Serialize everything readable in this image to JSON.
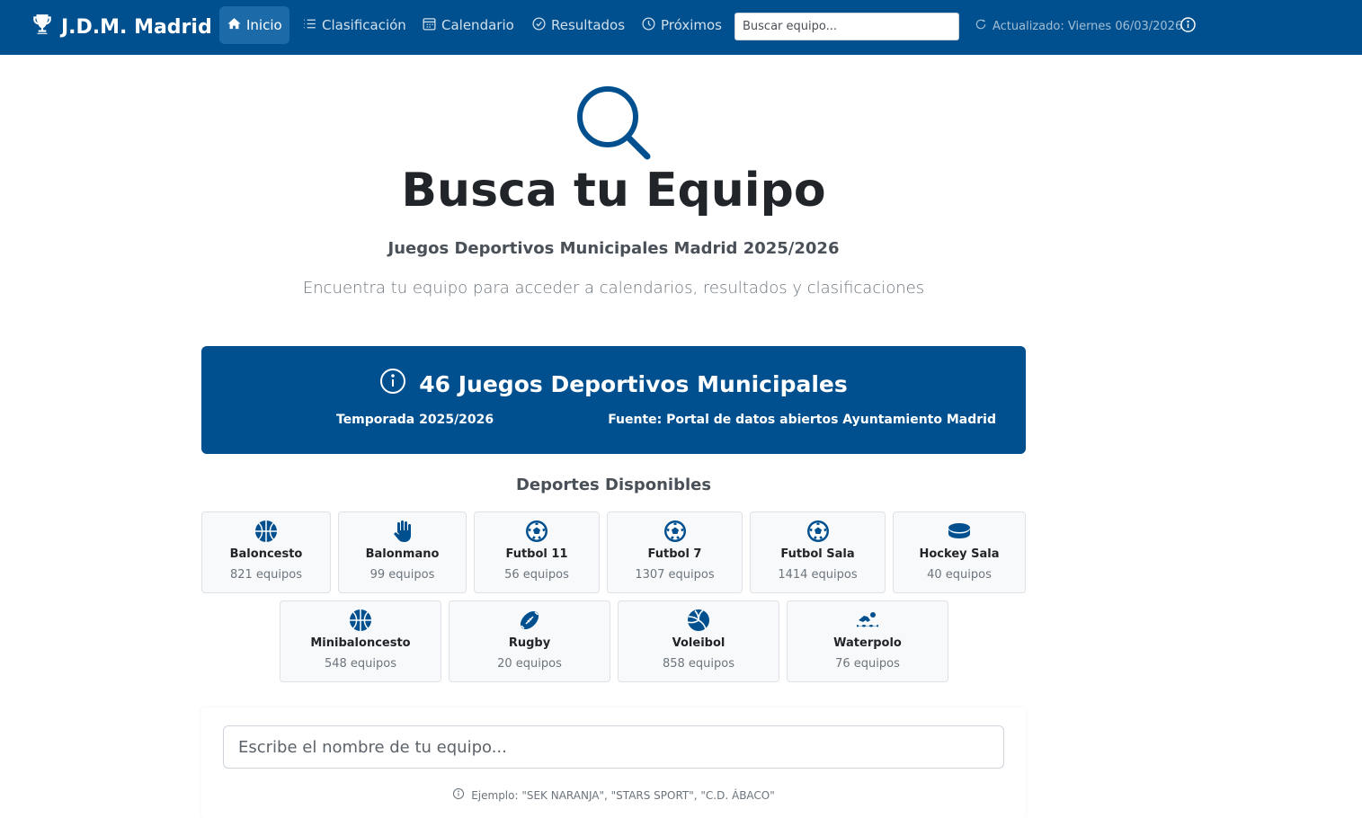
{
  "brand": {
    "name": "J.D.M. Madrid",
    "icon": "trophy-icon"
  },
  "nav": {
    "items": [
      {
        "label": "Inicio",
        "icon": "home-icon",
        "active": true
      },
      {
        "label": "Clasificación",
        "icon": "list-icon"
      },
      {
        "label": "Calendario",
        "icon": "calendar-icon"
      },
      {
        "label": "Resultados",
        "icon": "check-circle-icon"
      },
      {
        "label": "Próximos",
        "icon": "clock-icon"
      }
    ],
    "search_placeholder": "Buscar equipo...",
    "updated": "Actualizado: Viernes 06/03/2026"
  },
  "hero": {
    "icon": "search-icon",
    "title": "Busca tu Equipo",
    "subtitle": "Juegos Deportivos Municipales Madrid 2025/2026",
    "lead": "Encuentra tu equipo para acceder a calendarios, resultados y clasificaciones"
  },
  "banner": {
    "title": "46 Juegos Deportivos Municipales",
    "season": "Temporada 2025/2026",
    "source": "Fuente: Portal de datos abiertos Ayuntamiento Madrid"
  },
  "sports": {
    "title": "Deportes Disponibles",
    "items": [
      {
        "name": "Baloncesto",
        "count": "821 equipos",
        "icon": "basketball-icon"
      },
      {
        "name": "Balonmano",
        "count": "99 equipos",
        "icon": "hand-icon"
      },
      {
        "name": "Futbol 11",
        "count": "56 equipos",
        "icon": "soccer-ball-icon"
      },
      {
        "name": "Futbol 7",
        "count": "1307 equipos",
        "icon": "soccer-ball-icon"
      },
      {
        "name": "Futbol Sala",
        "count": "1414 equipos",
        "icon": "soccer-ball-icon"
      },
      {
        "name": "Hockey Sala",
        "count": "40 equipos",
        "icon": "hockey-puck-icon"
      },
      {
        "name": "Minibaloncesto",
        "count": "548 equipos",
        "icon": "basketball-icon"
      },
      {
        "name": "Rugby",
        "count": "20 equipos",
        "icon": "rugby-ball-icon"
      },
      {
        "name": "Voleibol",
        "count": "858 equipos",
        "icon": "volleyball-icon"
      },
      {
        "name": "Waterpolo",
        "count": "76 equipos",
        "icon": "swimmer-icon"
      }
    ]
  },
  "team_search": {
    "placeholder": "Escribe el nombre de tu equipo...",
    "hint": "Ejemplo: \"SEK NARANJA\", \"STARS SPORT\", \"C.D. ÁBACO\""
  },
  "colors": {
    "primary": "#00508f",
    "active_nav": "#1d6aa8",
    "card_bg": "#f8f9fa"
  }
}
